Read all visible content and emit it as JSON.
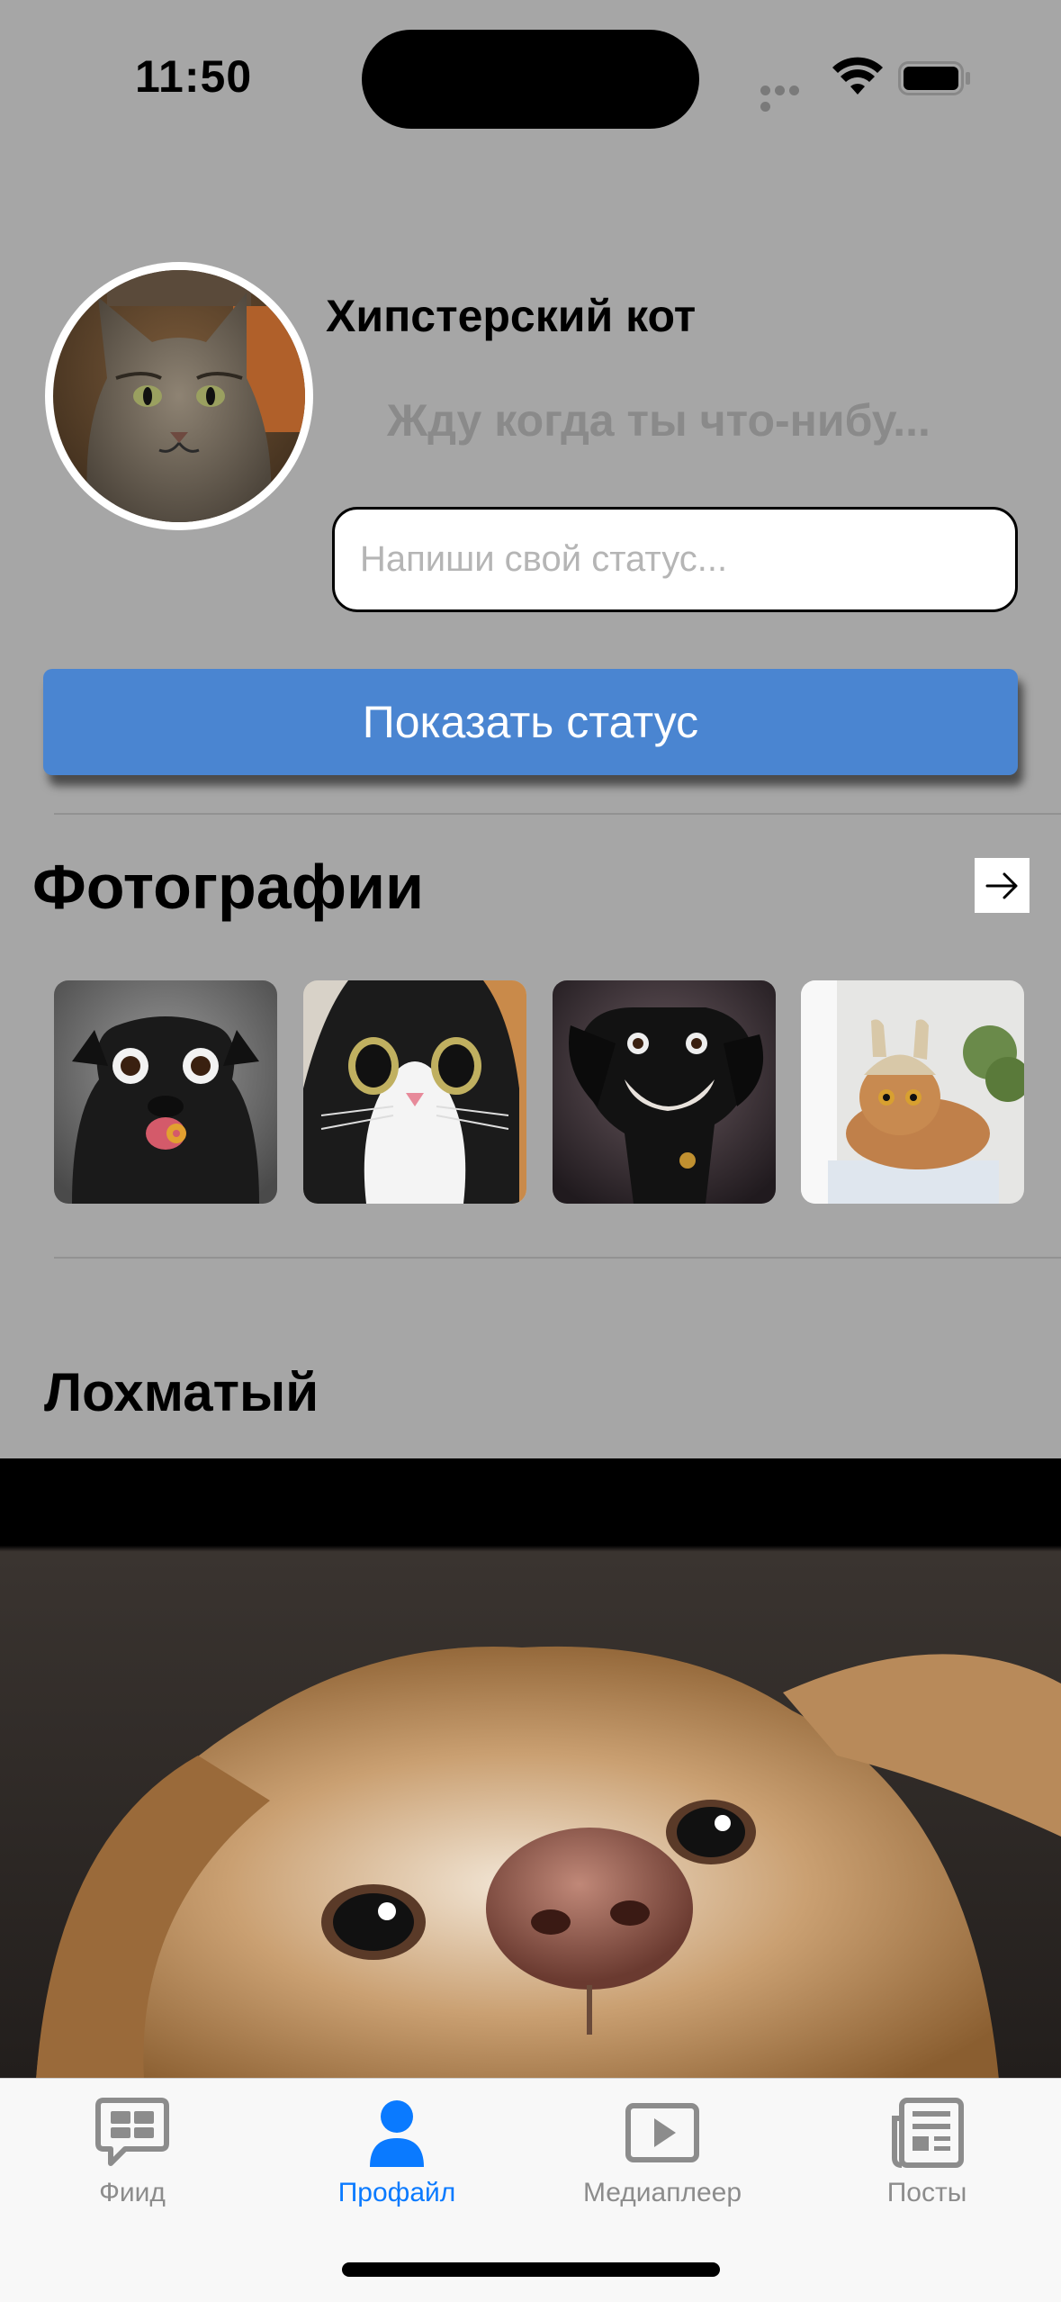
{
  "status_bar": {
    "time": "11:50"
  },
  "profile": {
    "name": "Хипстерский кот",
    "status": "Жду когда ты что-нибу...",
    "avatar": "cat-avatar",
    "status_input_placeholder": "Напиши свой статус...",
    "status_input_value": "",
    "show_status_button": "Показать статус"
  },
  "photos": {
    "title": "Фотографии",
    "arrow_icon": "arrow-right-icon",
    "items": [
      "pug-photo",
      "surprised-cat-photo",
      "black-dog-photo",
      "knit-hat-cat-photo"
    ]
  },
  "post": {
    "author": "Лохматый",
    "image": "funny-dog-photo"
  },
  "tab_bar": {
    "active_color": "#0a7aff",
    "inactive_color": "#8c8c8c",
    "tabs": [
      {
        "label": "Фиид",
        "icon": "feed-bubble-icon",
        "active": false
      },
      {
        "label": "Профайл",
        "icon": "person-icon",
        "active": true
      },
      {
        "label": "Медиаплеер",
        "icon": "play-rectangle-icon",
        "active": false
      },
      {
        "label": "Посты",
        "icon": "newspaper-icon",
        "active": false
      }
    ]
  },
  "colors": {
    "background": "#a6a6a6",
    "button": "#4a85d1"
  }
}
